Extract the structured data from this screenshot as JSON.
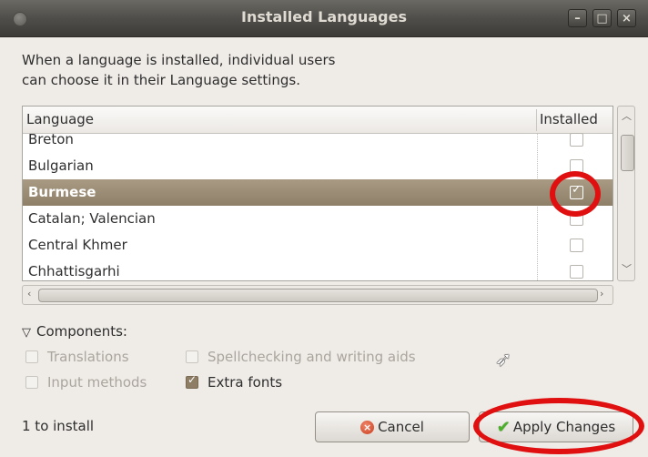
{
  "window": {
    "title": "Installed Languages",
    "minimize_glyph": "–",
    "maximize_glyph": "□",
    "close_glyph": "×"
  },
  "description": {
    "line1": "When a language is installed, individual users",
    "line2": "can choose it in their Language settings."
  },
  "table": {
    "col_language": "Language",
    "col_installed": "Installed",
    "rows": [
      {
        "language": "Breton",
        "installed": false,
        "selected": false
      },
      {
        "language": "Bulgarian",
        "installed": false,
        "selected": false
      },
      {
        "language": "Burmese",
        "installed": true,
        "selected": true
      },
      {
        "language": "Catalan; Valencian",
        "installed": false,
        "selected": false
      },
      {
        "language": "Central Khmer",
        "installed": false,
        "selected": false
      },
      {
        "language": "Chhattisgarhi",
        "installed": false,
        "selected": false
      }
    ]
  },
  "components": {
    "label": "Components:",
    "translations": {
      "label": "Translations",
      "checked": false,
      "enabled": false
    },
    "spellchecking": {
      "label": "Spellchecking and writing aids",
      "checked": false,
      "enabled": false
    },
    "input_methods": {
      "label": "Input methods",
      "checked": false,
      "enabled": false
    },
    "extra_fonts": {
      "label": "Extra fonts",
      "checked": true,
      "enabled": true
    }
  },
  "status": "1 to install",
  "buttons": {
    "cancel": "Cancel",
    "apply": "Apply Changes"
  },
  "colors": {
    "selection": "#998a73",
    "annotation": "#e01010",
    "titlebar": "#4f4e4a"
  },
  "icons": {
    "cancel": "cancel-icon",
    "apply": "checkmark-icon",
    "expander": "triangle-down-icon"
  }
}
